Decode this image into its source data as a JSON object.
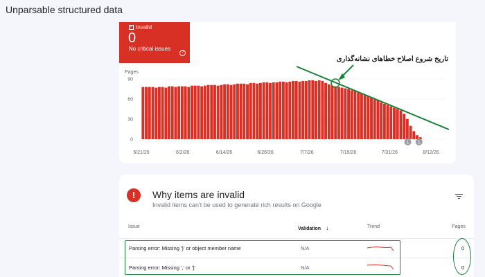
{
  "page": {
    "title": "Unparsable structured data"
  },
  "status_tile": {
    "label": "Invalid",
    "count": "0",
    "sub": "No critical issues",
    "help": "?"
  },
  "annotation": {
    "text": "تاریخ شروع اصلاح خطاهای نشانه‌گذاری"
  },
  "chart_data": {
    "type": "bar",
    "ylabel": "Pages",
    "ylim": [
      0,
      90
    ],
    "yticks": [
      0,
      30,
      60,
      90
    ],
    "xticks": [
      "5/21/26",
      "6/2/26",
      "6/14/26",
      "6/26/26",
      "7/7/26",
      "7/19/26",
      "7/31/26",
      "8/12/26"
    ],
    "values": [
      78,
      78,
      78,
      78,
      77,
      78,
      78,
      77,
      79,
      79,
      78,
      79,
      79,
      79,
      78,
      80,
      80,
      80,
      79,
      80,
      81,
      81,
      81,
      80,
      81,
      82,
      82,
      81,
      82,
      83,
      83,
      83,
      82,
      84,
      84,
      83,
      84,
      85,
      85,
      84,
      85,
      85,
      86,
      86,
      85,
      86,
      87,
      87,
      86,
      87,
      87,
      88,
      88,
      87,
      88,
      87,
      84,
      82,
      80,
      79,
      78,
      77,
      76,
      75,
      73,
      72,
      70,
      68,
      66,
      64,
      62,
      60,
      58,
      55,
      53,
      51,
      49,
      47,
      45,
      43,
      38,
      30,
      20,
      12,
      6,
      3,
      0,
      0,
      0,
      0,
      0,
      0,
      0
    ],
    "markers": [
      "1",
      "1"
    ],
    "colors": {
      "bar": "#d93025",
      "trend_line": "#188038",
      "axis_text": "#5f6368"
    }
  },
  "issues": {
    "title": "Why items are invalid",
    "subtitle": "Invalid items can't be used to generate rich results on Google",
    "icon": "!",
    "columns": {
      "issue": "Issue",
      "validation": "Validation",
      "sort": "↓",
      "trend": "Trend",
      "pages": "Pages"
    },
    "rows": [
      {
        "issue": "Parsing error: Missing '}' or object member name",
        "validation": "N/A",
        "pages": "0"
      },
      {
        "issue": "Parsing error: Missing ',' or '}'",
        "validation": "N/A",
        "pages": "0"
      }
    ]
  }
}
